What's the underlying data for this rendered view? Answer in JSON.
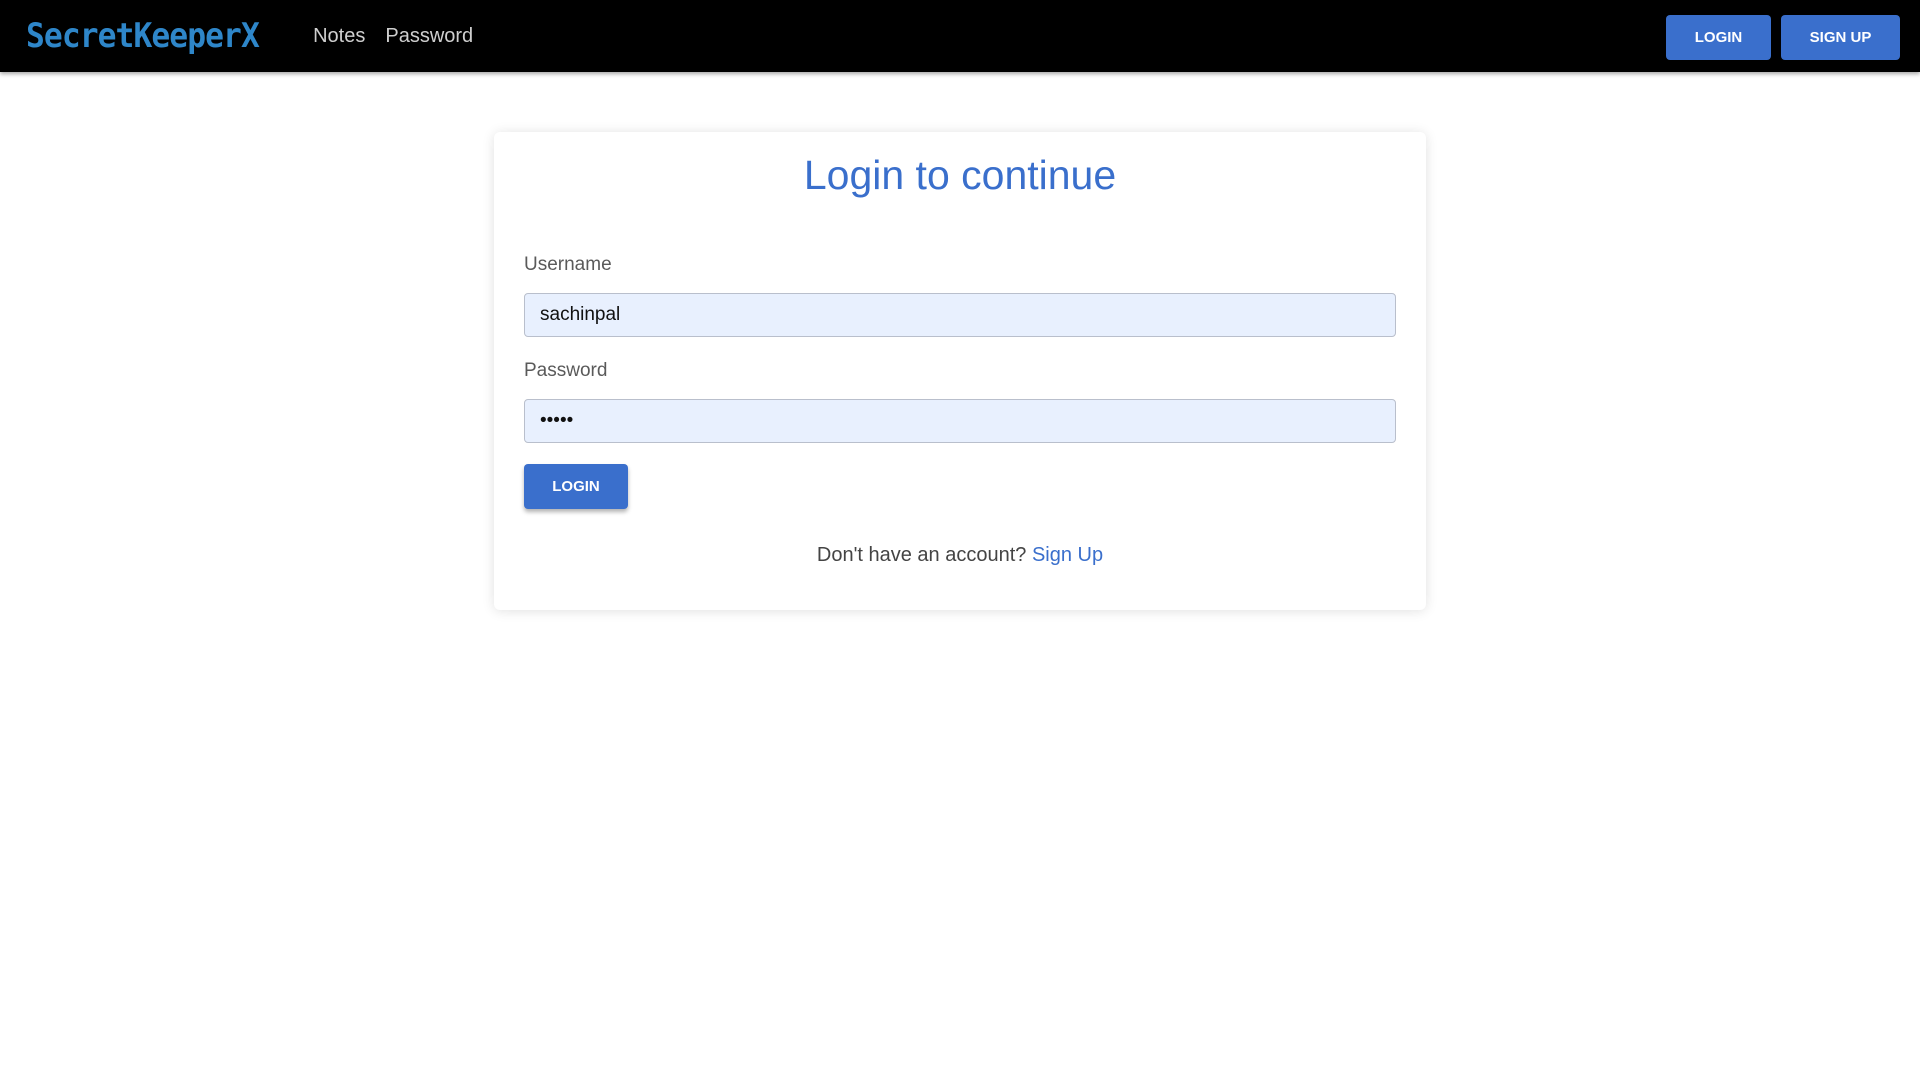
{
  "navbar": {
    "brand": "SecretKeeperX",
    "links": [
      "Notes",
      "Password"
    ],
    "login_label": "LOGIN",
    "signup_label": "SIGN UP"
  },
  "login_card": {
    "title": "Login to continue",
    "username_label": "Username",
    "username_value": "sachinpal",
    "password_label": "Password",
    "password_value": "•••••",
    "submit_label": "LOGIN",
    "signup_prompt": "Don't have an account?",
    "signup_link": "Sign Up"
  },
  "colors": {
    "brand": "#2e86c9",
    "accent": "#3a6fcc",
    "navbar_bg": "#000000",
    "input_bg": "#e8f0fe"
  }
}
